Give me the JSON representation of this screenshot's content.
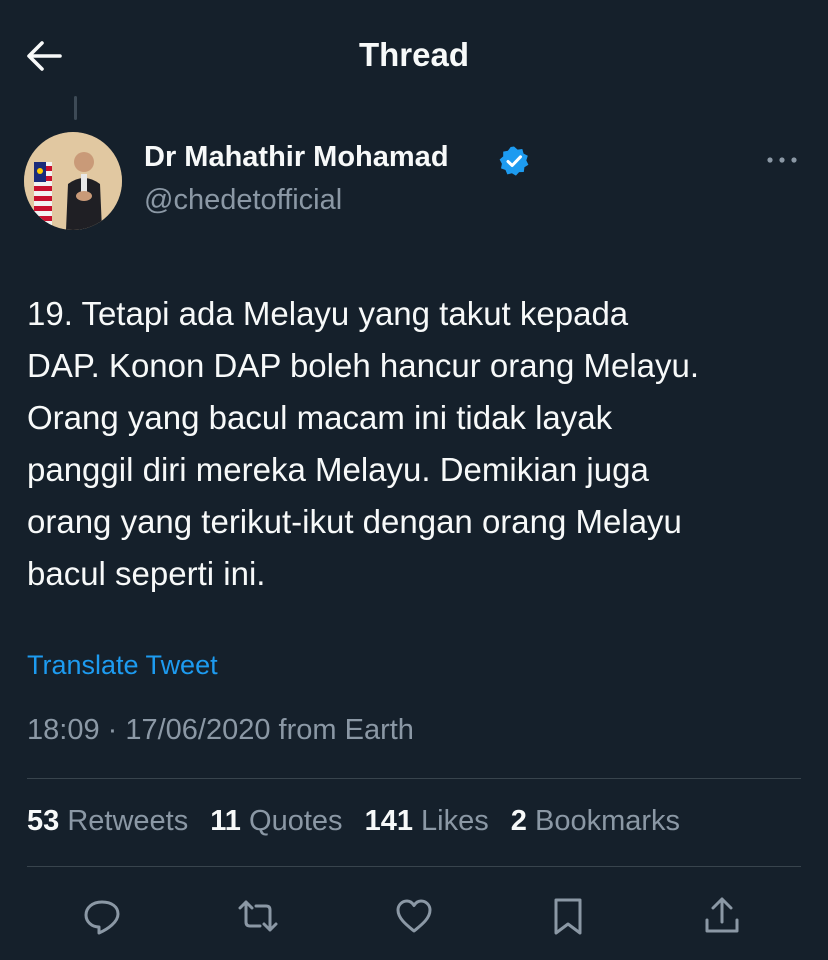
{
  "header": {
    "title": "Thread",
    "back_icon": "arrow-left-icon"
  },
  "tweet": {
    "author": {
      "name": "Dr Mahathir Mohamad",
      "handle": "@chedetofficial",
      "verified": true,
      "verified_color": "#1d9bf0"
    },
    "text_lines": [
      "19. Tetapi ada Melayu yang takut kepada",
      "DAP. Konon DAP boleh hancur orang Melayu.",
      "Orang yang bacul macam ini tidak layak",
      "panggil diri mereka Melayu. Demikian juga",
      "orang yang terikut-ikut dengan orang Melayu",
      "bacul seperti ini."
    ],
    "translate_label": "Translate Tweet",
    "timestamp": "18:09 · 17/06/2020 from Earth",
    "stats": [
      {
        "count": "53",
        "label": "Retweets"
      },
      {
        "count": "11",
        "label": "Quotes"
      },
      {
        "count": "141",
        "label": "Likes"
      },
      {
        "count": "2",
        "label": "Bookmarks"
      }
    ],
    "actions": [
      "reply-icon",
      "retweet-icon",
      "like-icon",
      "bookmark-icon",
      "share-icon"
    ]
  },
  "colors": {
    "background": "#15202b",
    "text": "#f7f9f9",
    "secondary_text": "#8b98a5",
    "link": "#1d9bf0",
    "divider": "#38444d"
  }
}
